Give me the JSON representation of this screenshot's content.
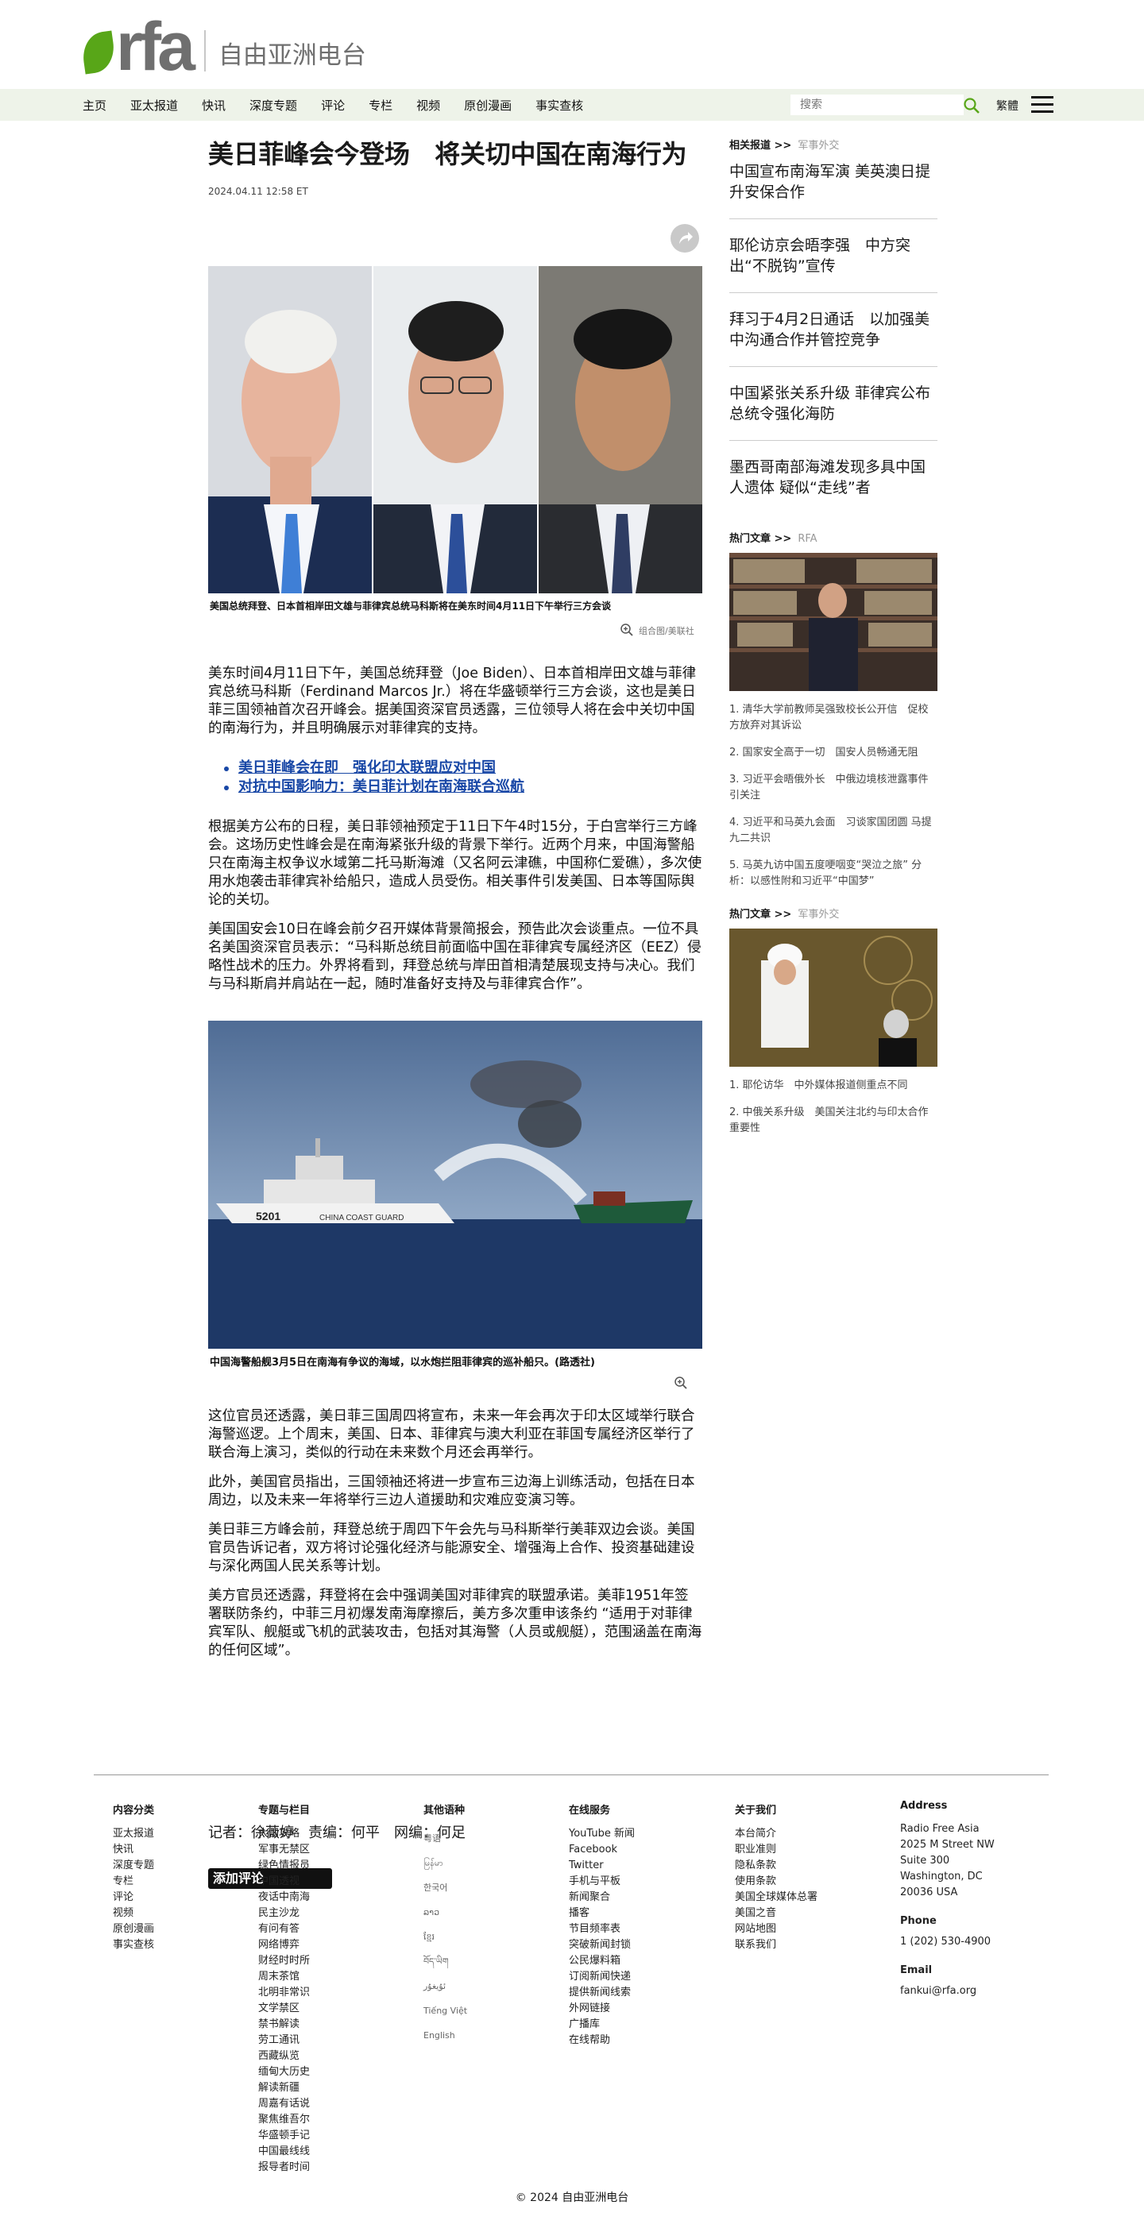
{
  "header": {
    "logo_text": "rfa",
    "site_name": "自由亚洲电台"
  },
  "nav": {
    "items": [
      "主页",
      "亚太报道",
      "快讯",
      "深度专题",
      "评论",
      "专栏",
      "视频",
      "原创漫画",
      "事实查核"
    ],
    "search_placeholder": "搜索",
    "lang_toggle": "繁體"
  },
  "article": {
    "title": "美日菲峰会今登场　将关切中国在南海行为",
    "date": "2024.04.11 12:58 ET",
    "hero_caption": "美国总统拜登、日本首相岸田文雄与菲律宾总统马科斯将在美东时间4月11日下午举行三方会谈",
    "hero_credit": "组合图/美联社",
    "p1": "美东时间4月11日下午，美国总统拜登（Joe Biden）、日本首相岸田文雄与菲律宾总统马科斯（Ferdinand Marcos Jr.）将在华盛顿举行三方会谈，这也是美日菲三国领袖首次召开峰会。据美国资深官员透露，三位领导人将在会中关切中国的南海行为，并且明确展示对菲律宾的支持。",
    "links": [
      "美日菲峰会在即　强化印太联盟应对中国",
      "对抗中国影响力：美日菲计划在南海联合巡航"
    ],
    "p2": "根据美方公布的日程，美日菲领袖预定于11日下午4时15分，于白宫举行三方峰会。这场历史性峰会是在南海紧张升级的背景下举行。近两个月来，中国海警船只在南海主权争议水域第二托马斯海滩（又名阿云津礁，中国称仁爱礁），多次使用水炮袭击菲律宾补给船只，造成人员受伤。相关事件引发美国、日本等国际舆论的关切。",
    "p3": "美国国安会10日在峰会前夕召开媒体背景简报会，预告此次会谈重点。一位不具名美国资深官员表示：“马科斯总统目前面临中国在菲律宾专属经济区（EEZ）侵略性战术的压力。外界将看到，拜登总统与岸田首相清楚展现支持与决心。我们与马科斯肩并肩站在一起，随时准备好支持及与菲律宾合作”。",
    "photo2_caption": "中国海警船舰3月5日在南海有争议的海域，以水炮拦阻菲律宾的巡补船只。(路透社)",
    "p4": "这位官员还透露，美日菲三国周四将宣布，未来一年会再次于印太区域举行联合海警巡逻。上个周末，美国、日本、菲律宾与澳大利亚在菲国专属经济区举行了联合海上演习，类似的行动在未来数个月还会再举行。",
    "p5": "此外，美国官员指出，三国领袖还将进一步宣布三边海上训练活动，包括在日本周边，以及未来一年将举行三边人道援助和灾难应变演习等。",
    "p6": "美日菲三方峰会前，拜登总统于周四下午会先与马科斯举行美菲双边会谈。美国官员告诉记者，双方将讨论强化经济与能源安全、增强海上合作、投资基础建设与深化两国人民关系等计划。",
    "p7": "美方官员还透露，拜登将在会中强调美国对菲律宾的联盟承诺。美菲1951年签署联防条约，中菲三月初爆发南海摩擦后，美方多次重申该条约 “适用于对菲律宾军队、舰艇或飞机的武装攻击，包括对其海警（人员或舰艇），范围涵盖在南海的任何区域”。",
    "byline": "记者：徐薇婷　责编：何平　网编：何足",
    "comment_button": "添加评论",
    "ship_label": "CHINA COAST GUARD",
    "ship_number": "5201"
  },
  "sidebar": {
    "related_heading": "相关报道 >>",
    "related_tag": "军事外交",
    "related": [
      "中国宣布南海军演 美英澳日提升安保合作",
      "耶伦访京会晤李强　中方突出“不脱钩”宣传",
      "拜习于4月2日通话　以加强美中沟通合作并管控竞争",
      "中国紧张关系升级 菲律宾公布总统令强化海防",
      "墨西哥南部海滩发现多具中国人遗体 疑似“走线”者"
    ],
    "hot1_heading": "热门文章 >>",
    "hot1_tag": "RFA",
    "hot1": [
      "1. 清华大学前教师吴强致校长公开信　促校方放弃对其诉讼",
      "2. 国家安全高于一切　国安人员畅通无阻",
      "3. 习近平会晤俄外长　中俄边境核泄露事件引关注",
      "4. 习近平和马英九会面　习谈家国团圆 马提九二共识",
      "5. 马英九访中国五度哽咽变“哭泣之旅” 分析：以感性附和习近平“中国梦”"
    ],
    "hot2_heading": "热门文章 >>",
    "hot2_tag": "军事外交",
    "hot2": [
      "1. 耶伦访华　中外媒体报道侧重点不同",
      "2. 中俄关系升级　美国关注北约与印太合作重要性"
    ]
  },
  "footer": {
    "col1": {
      "heading": "内容分类",
      "items": [
        "亚太报道",
        "快讯",
        "深度专题",
        "专栏",
        "评论",
        "视频",
        "原创漫画",
        "事实查核"
      ]
    },
    "col2": {
      "heading": "专题与栏目",
      "items": [
        "大国攻略",
        "军事无禁区",
        "绿色情报员",
        "中国透视",
        "夜话中南海",
        "民主沙龙",
        "有问有答",
        "网络博弈",
        "财经时时所",
        "周末茶馆",
        "北明非常识",
        "文学禁区",
        "禁书解读",
        "劳工通讯",
        "西藏纵览",
        "缅甸大历史",
        "解读新疆",
        "周嘉有话说",
        "聚焦维吾尔",
        "华盛顿手记",
        "中国最线线",
        "报导者时间"
      ]
    },
    "col3": {
      "heading": "其他语种",
      "items": [
        "粤语",
        "မြန်မာ",
        "한국어",
        "ລາວ",
        "ខ្មែរ",
        "བོད་ཡིག",
        "ئۇيغۇر",
        "Tiếng Việt",
        "English"
      ]
    },
    "col4": {
      "heading": "在线服务",
      "items": [
        "YouTube 新闻",
        "Facebook",
        "Twitter",
        "手机与平板",
        "新闻聚合",
        "播客",
        "节目频率表",
        "突破新闻封锁",
        "公民爆料箱",
        "订阅新闻快递",
        "提供新闻线索",
        "外网链接",
        "广播库",
        "在线帮助"
      ]
    },
    "col5": {
      "heading": "关于我们",
      "items": [
        "本台简介",
        "职业准则",
        "隐私条款",
        "使用条款",
        "美国全球媒体总署",
        "美国之音",
        "网站地图",
        "联系我们"
      ]
    },
    "col6": {
      "address_heading": "Address",
      "address": [
        "Radio Free Asia",
        "2025 M Street NW",
        "Suite 300",
        "Washington, DC",
        "20036 USA"
      ],
      "phone_heading": "Phone",
      "phone": "1 (202) 530-4900",
      "email_heading": "Email",
      "email": "fankui@rfa.org"
    },
    "copyright": "© 2024 自由亚洲电台"
  },
  "colors": {
    "brand_green": "#58a618",
    "nav_bg": "#eef3e9",
    "link_blue": "#1847a6"
  }
}
